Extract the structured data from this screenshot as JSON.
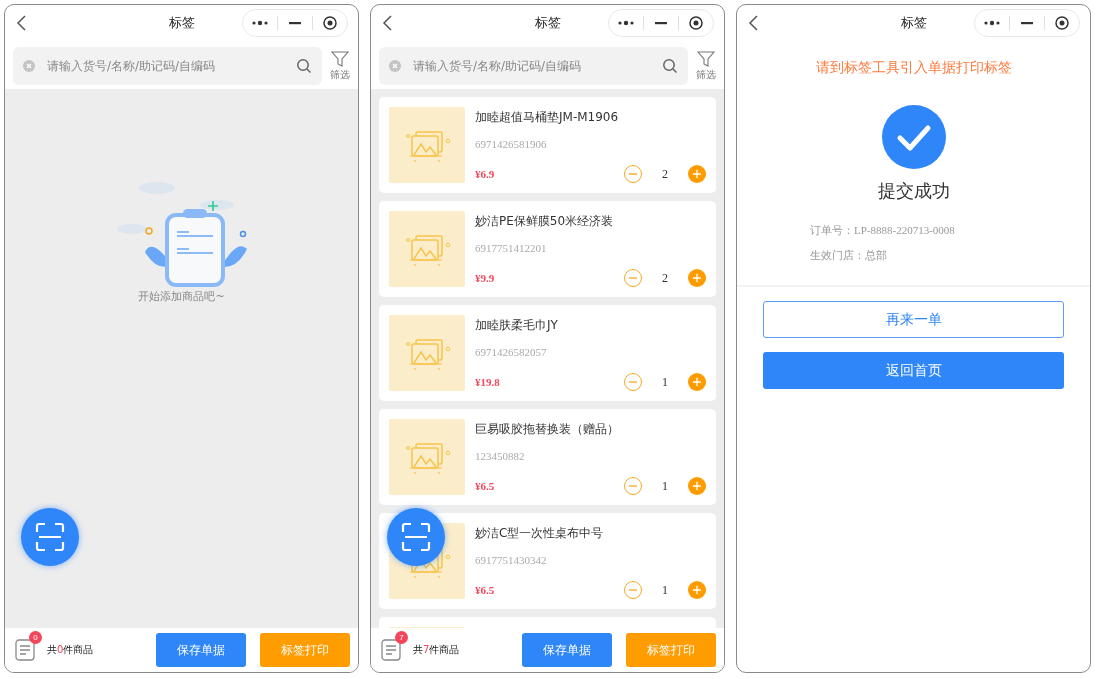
{
  "screens": [
    {
      "kind": "empty",
      "title": "标签",
      "search": {
        "placeholder": "请输入货号/名称/助记码/自编码"
      },
      "filter_label": "筛选",
      "empty_text": "开始添加商品吧~",
      "footer": {
        "badge": "0",
        "summary_prefix": "共",
        "summary_count": "0",
        "summary_suffix": "件商品",
        "buttons": [
          "保存单据",
          "标签打印"
        ]
      }
    },
    {
      "kind": "list",
      "title": "标签",
      "search": {
        "placeholder": "请输入货号/名称/助记码/自编码"
      },
      "filter_label": "筛选",
      "products": [
        {
          "name": "加睦超值马桶垫JM-M1906",
          "code": "6971426581906",
          "price": "¥6.9",
          "qty": "2"
        },
        {
          "name": "妙洁PE保鲜膜50米经济装",
          "code": "6917751412201",
          "price": "¥9.9",
          "qty": "2"
        },
        {
          "name": "加睦肤柔毛巾JY",
          "code": "6971426582057",
          "price": "¥19.8",
          "qty": "1"
        },
        {
          "name": "巨易吸胶拖替换装（赠品）",
          "code": "123450882",
          "price": "¥6.5",
          "qty": "1"
        },
        {
          "name": "妙洁C型一次性桌布中号",
          "code": "6917751430342",
          "price": "¥6.5",
          "qty": "1"
        }
      ],
      "footer": {
        "badge": "7",
        "summary_prefix": "共",
        "summary_count": "7",
        "summary_suffix": "件商品",
        "buttons": [
          "保存单据",
          "标签打印"
        ]
      }
    },
    {
      "kind": "success",
      "title": "标签",
      "notice": "请到标签工具引入单据打印标签",
      "status": "提交成功",
      "details": [
        "订单号：LP-8888-220713-0008",
        "生效门店：总部"
      ],
      "buttons": [
        "再来一单",
        "返回首页"
      ]
    }
  ]
}
